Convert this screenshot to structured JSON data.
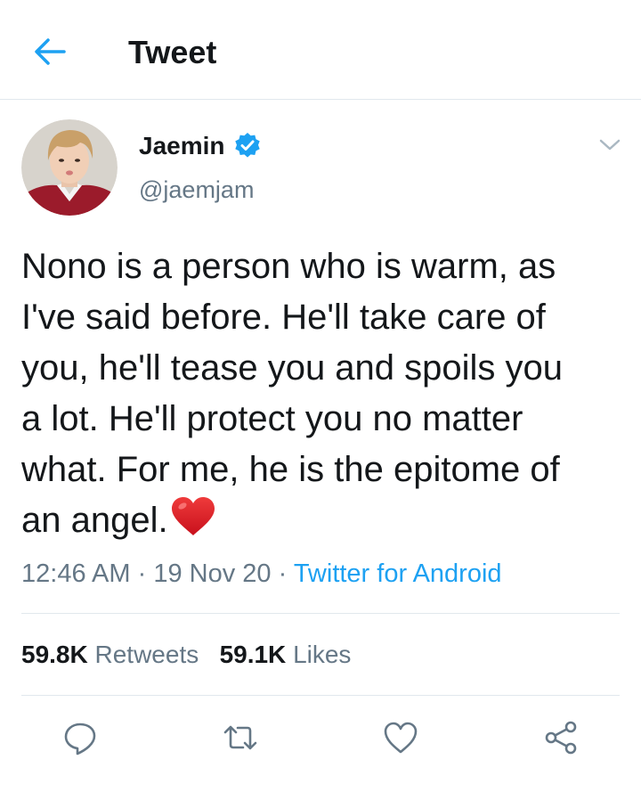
{
  "header": {
    "title": "Tweet",
    "back_icon": "arrow-left-icon",
    "accent_color": "#1da1f2"
  },
  "tweet": {
    "author": {
      "display_name": "Jaemin",
      "handle": "@jaemjam",
      "verified_icon": "verified-badge-icon"
    },
    "text_lines": [
      "Nono is a person who is warm, as",
      "I've said before. He'll take care of",
      "you, he'll tease you and spoils you",
      "a lot.  He'll protect you no matter",
      "what. For me,  he is the epitome of",
      "an angel."
    ],
    "emoji": "red-heart-emoji",
    "time": "12:46 AM",
    "date": "19 Nov 20",
    "separator": "·",
    "source": "Twitter for Android"
  },
  "stats": {
    "retweets_count": "59.8K",
    "retweets_label": "Retweets",
    "likes_count": "59.1K",
    "likes_label": "Likes"
  },
  "actions": [
    "reply-icon",
    "retweet-icon",
    "like-icon",
    "share-icon"
  ]
}
